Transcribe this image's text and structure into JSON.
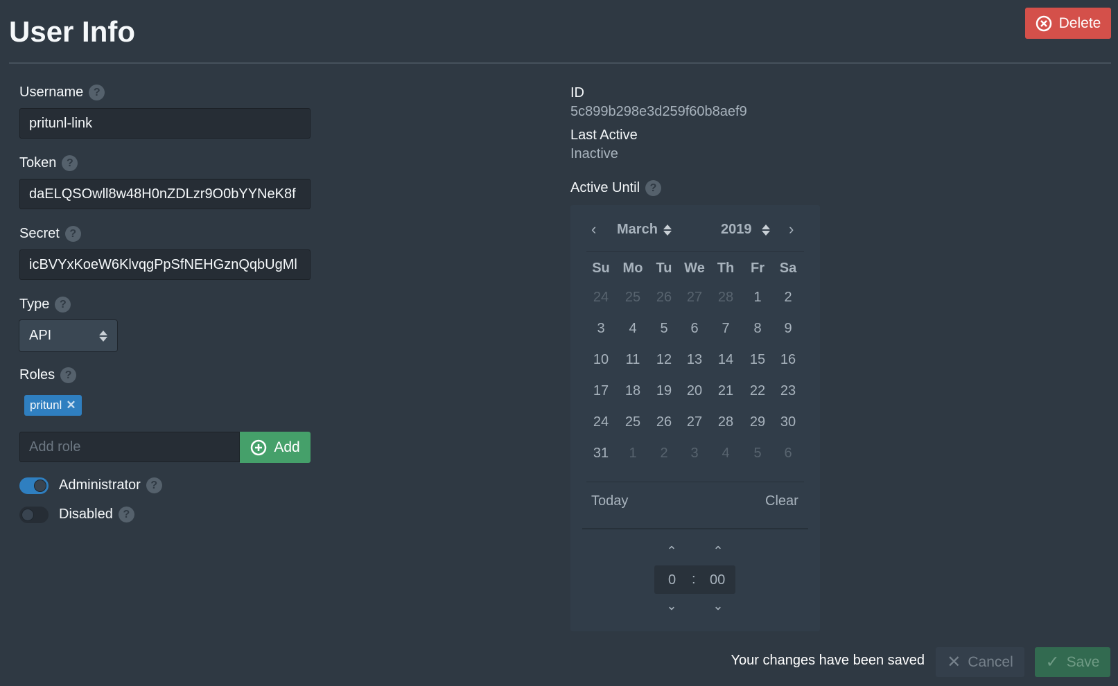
{
  "header": {
    "title": "User Info",
    "delete_label": "Delete"
  },
  "form": {
    "username": {
      "label": "Username",
      "value": "pritunl-link"
    },
    "token": {
      "label": "Token",
      "value": "daELQSOwll8w48H0nZDLzr9O0bYYNeK8f"
    },
    "secret": {
      "label": "Secret",
      "value": "icBVYxKoeW6KlvqgPpSfNEHGznQqbUgMl"
    },
    "type": {
      "label": "Type",
      "value": "API"
    },
    "roles": {
      "label": "Roles",
      "items": [
        "pritunl"
      ],
      "remove_glyph": "✕",
      "add_placeholder": "Add role",
      "add_label": "Add"
    },
    "administrator": {
      "label": "Administrator",
      "on": true
    },
    "disabled": {
      "label": "Disabled",
      "on": false
    }
  },
  "info": {
    "id_label": "ID",
    "id_value": "5c899b298e3d259f60b8aef9",
    "last_active_label": "Last Active",
    "last_active_value": "Inactive",
    "active_until_label": "Active Until"
  },
  "calendar": {
    "month": "March",
    "year": "2019",
    "weekdays": [
      "Su",
      "Mo",
      "Tu",
      "We",
      "Th",
      "Fr",
      "Sa"
    ],
    "weeks": [
      [
        {
          "d": "24",
          "out": true
        },
        {
          "d": "25",
          "out": true
        },
        {
          "d": "26",
          "out": true
        },
        {
          "d": "27",
          "out": true
        },
        {
          "d": "28",
          "out": true
        },
        {
          "d": "1"
        },
        {
          "d": "2"
        }
      ],
      [
        {
          "d": "3"
        },
        {
          "d": "4"
        },
        {
          "d": "5"
        },
        {
          "d": "6"
        },
        {
          "d": "7"
        },
        {
          "d": "8"
        },
        {
          "d": "9"
        }
      ],
      [
        {
          "d": "10"
        },
        {
          "d": "11"
        },
        {
          "d": "12"
        },
        {
          "d": "13"
        },
        {
          "d": "14"
        },
        {
          "d": "15"
        },
        {
          "d": "16"
        }
      ],
      [
        {
          "d": "17"
        },
        {
          "d": "18"
        },
        {
          "d": "19"
        },
        {
          "d": "20"
        },
        {
          "d": "21"
        },
        {
          "d": "22"
        },
        {
          "d": "23"
        }
      ],
      [
        {
          "d": "24"
        },
        {
          "d": "25"
        },
        {
          "d": "26"
        },
        {
          "d": "27"
        },
        {
          "d": "28"
        },
        {
          "d": "29"
        },
        {
          "d": "30"
        }
      ],
      [
        {
          "d": "31"
        },
        {
          "d": "1",
          "out": true
        },
        {
          "d": "2",
          "out": true
        },
        {
          "d": "3",
          "out": true
        },
        {
          "d": "4",
          "out": true
        },
        {
          "d": "5",
          "out": true
        },
        {
          "d": "6",
          "out": true
        }
      ]
    ],
    "today_label": "Today",
    "clear_label": "Clear",
    "hour": "0",
    "separator": ":",
    "minute": "00"
  },
  "footer": {
    "message": "Your changes have been saved",
    "cancel_label": "Cancel",
    "save_label": "Save"
  },
  "colors": {
    "background": "#2f3943",
    "danger": "#d4504a",
    "success": "#45a06a",
    "primary": "#2f7fc0"
  }
}
